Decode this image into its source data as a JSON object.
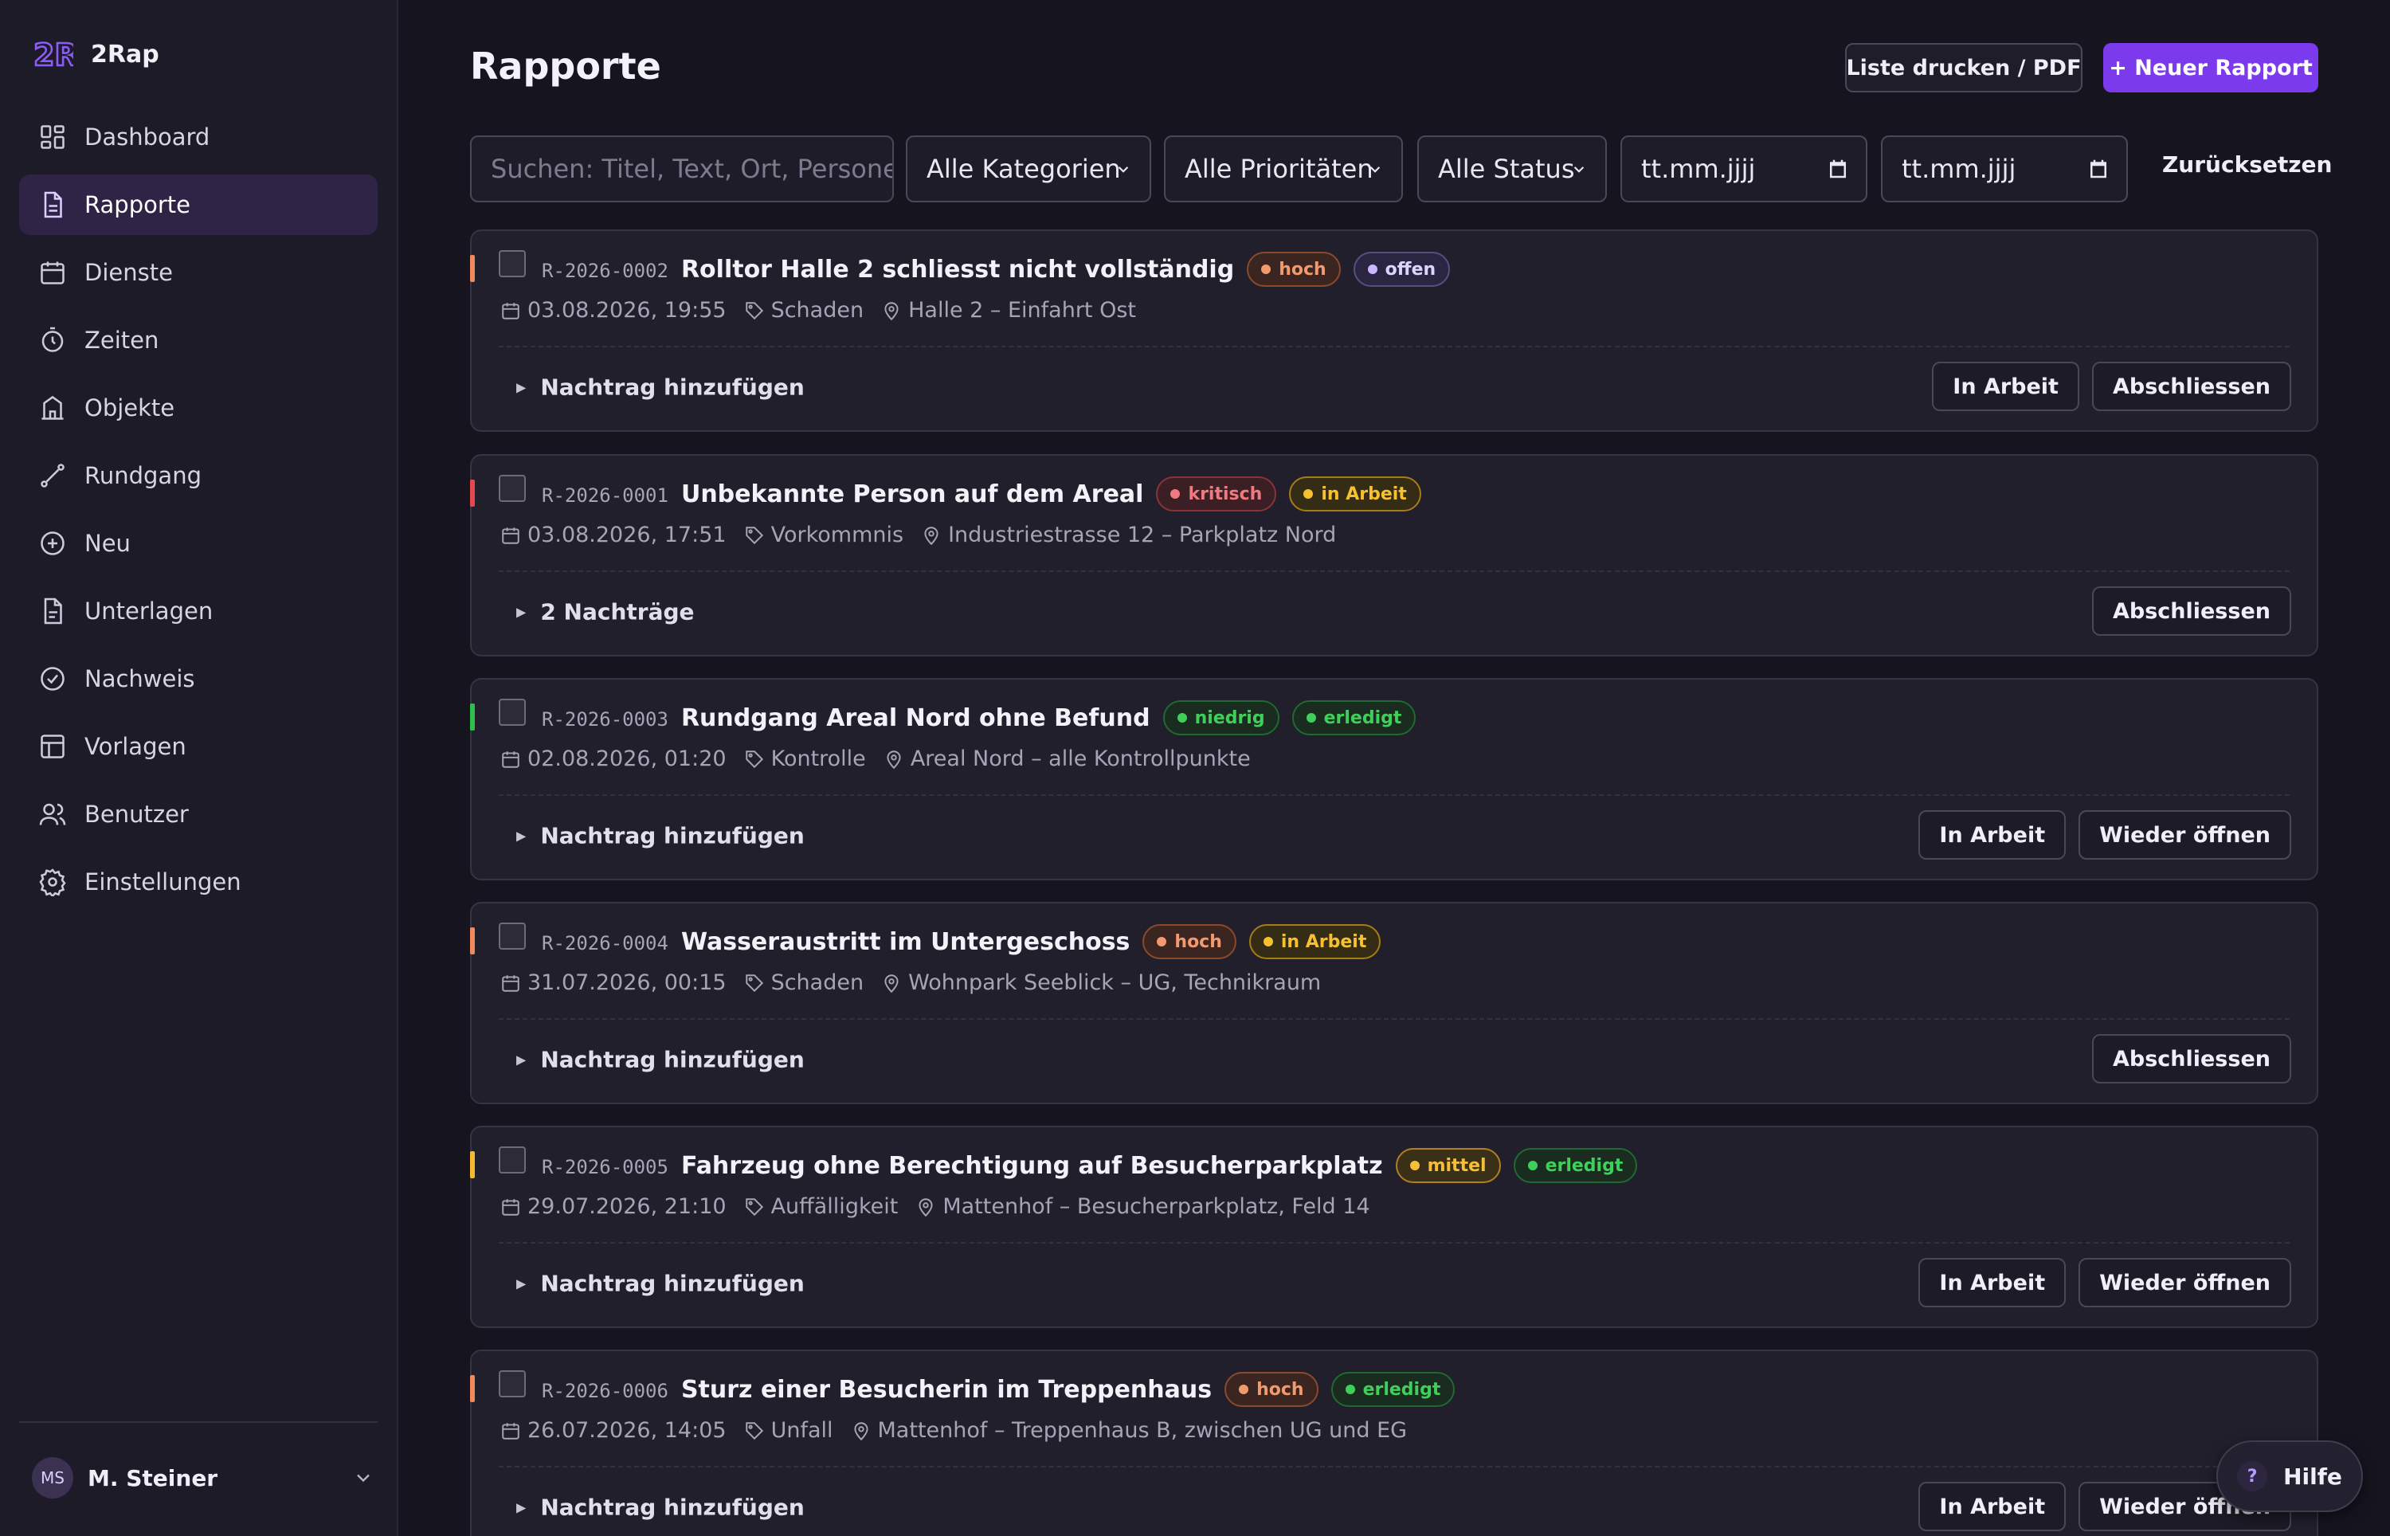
{
  "app": {
    "name": "2Rap",
    "logo_text": "2R"
  },
  "sidebar": {
    "items": [
      {
        "label": "Dashboard",
        "icon": "dashboard-icon",
        "active": false
      },
      {
        "label": "Rapporte",
        "icon": "document-icon",
        "active": true
      },
      {
        "label": "Dienste",
        "icon": "calendar-icon",
        "active": false
      },
      {
        "label": "Zeiten",
        "icon": "stopwatch-icon",
        "active": false
      },
      {
        "label": "Objekte",
        "icon": "building-icon",
        "active": false
      },
      {
        "label": "Rundgang",
        "icon": "route-icon",
        "active": false
      },
      {
        "label": "Neu",
        "icon": "plus-circle-icon",
        "active": false
      },
      {
        "label": "Unterlagen",
        "icon": "file-icon",
        "active": false
      },
      {
        "label": "Nachweis",
        "icon": "check-circle-icon",
        "active": false
      },
      {
        "label": "Vorlagen",
        "icon": "template-icon",
        "active": false
      },
      {
        "label": "Benutzer",
        "icon": "users-icon",
        "active": false
      },
      {
        "label": "Einstellungen",
        "icon": "gear-icon",
        "active": false
      }
    ],
    "user": {
      "initials": "MS",
      "name": "M. Steiner"
    }
  },
  "header": {
    "title": "Rapporte",
    "print_label": "Liste drucken / PDF",
    "new_label": "+ Neuer Rapport"
  },
  "filters": {
    "search_placeholder": "Suchen: Titel, Text, Ort, Personen, I",
    "category": "Alle Kategorien",
    "priority": "Alle Prioritäten",
    "status": "Alle Status",
    "date_from": "tt.mm.jjjj",
    "date_to": "tt.mm.jjjj",
    "reset_label": "Zurücksetzen"
  },
  "reports": [
    {
      "id": "R-2026-0002",
      "title": "Rolltor Halle 2 schliesst nicht vollständig",
      "priority": "hoch",
      "status": "offen",
      "date": "03.08.2026, 19:55",
      "category": "Schaden",
      "location": "Halle 2 – Einfahrt Ost",
      "nachtrag": "Nachtrag hinzufügen",
      "actions": [
        "In Arbeit",
        "Abschliessen"
      ],
      "accent": "#f08a5d"
    },
    {
      "id": "R-2026-0001",
      "title": "Unbekannte Person auf dem Areal",
      "priority": "kritisch",
      "status": "in Arbeit",
      "date": "03.08.2026, 17:51",
      "category": "Vorkommnis",
      "location": "Industriestrasse 12 – Parkplatz Nord",
      "nachtrag": "2 Nachträge",
      "actions": [
        "Abschliessen"
      ],
      "accent": "#e5484d"
    },
    {
      "id": "R-2026-0003",
      "title": "Rundgang Areal Nord ohne Befund",
      "priority": "niedrig",
      "status": "erledigt",
      "date": "02.08.2026, 01:20",
      "category": "Kontrolle",
      "location": "Areal Nord – alle Kontrollpunkte",
      "nachtrag": "Nachtrag hinzufügen",
      "actions": [
        "In Arbeit",
        "Wieder öffnen"
      ],
      "accent": "#2fbf4a"
    },
    {
      "id": "R-2026-0004",
      "title": "Wasseraustritt im Untergeschoss",
      "priority": "hoch",
      "status": "in Arbeit",
      "date": "31.07.2026, 00:15",
      "category": "Schaden",
      "location": "Wohnpark Seeblick – UG, Technikraum",
      "nachtrag": "Nachtrag hinzufügen",
      "actions": [
        "Abschliessen"
      ],
      "accent": "#f08a5d"
    },
    {
      "id": "R-2026-0005",
      "title": "Fahrzeug ohne Berechtigung auf Besucherparkplatz",
      "priority": "mittel",
      "status": "erledigt",
      "date": "29.07.2026, 21:10",
      "category": "Auffälligkeit",
      "location": "Mattenhof – Besucherparkplatz, Feld 14",
      "nachtrag": "Nachtrag hinzufügen",
      "actions": [
        "In Arbeit",
        "Wieder öffnen"
      ],
      "accent": "#f5b82e"
    },
    {
      "id": "R-2026-0006",
      "title": "Sturz einer Besucherin im Treppenhaus",
      "priority": "hoch",
      "status": "erledigt",
      "date": "26.07.2026, 14:05",
      "category": "Unfall",
      "location": "Mattenhof – Treppenhaus B, zwischen UG und EG",
      "nachtrag": "Nachtrag hinzufügen",
      "actions": [
        "In Arbeit",
        "Wieder öffnen"
      ],
      "accent": "#f08a5d"
    }
  ],
  "help": {
    "label": "Hilfe",
    "glyph": "?"
  },
  "colors": {
    "accent": "#7c3aed",
    "background": "#16141f",
    "sidebar": "#1d1b28"
  }
}
